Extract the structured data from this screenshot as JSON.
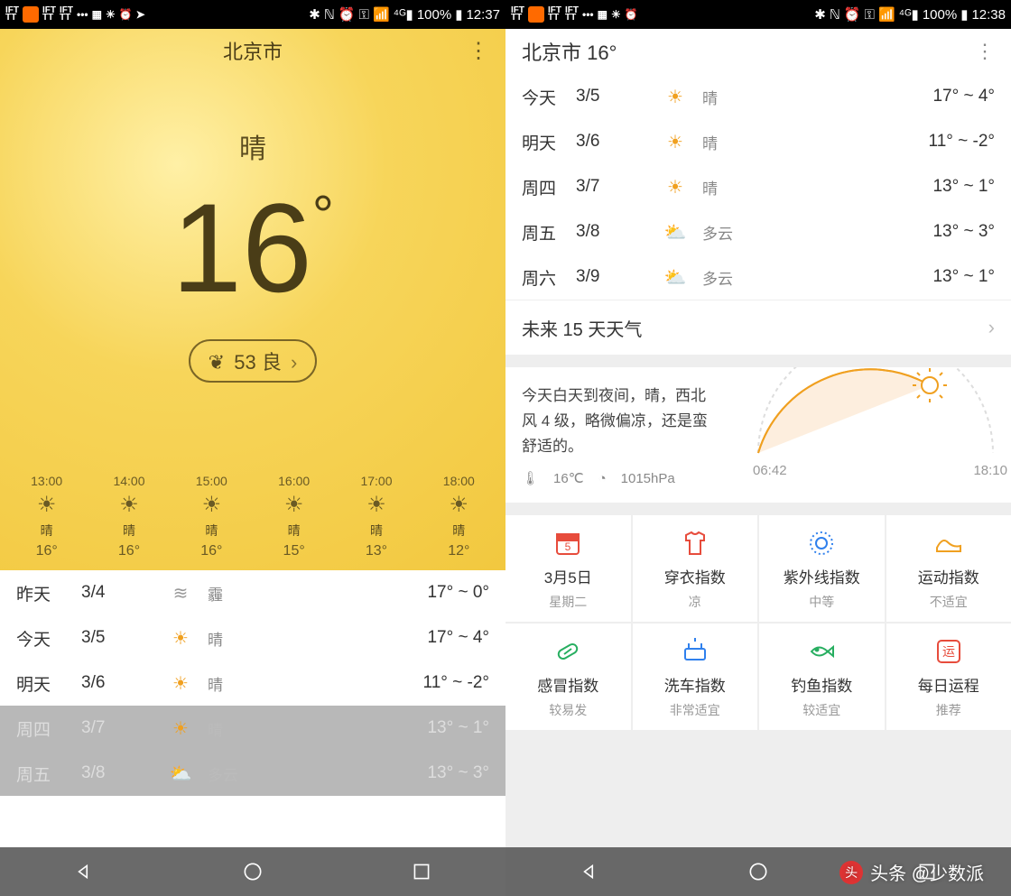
{
  "statusbar": {
    "left_items": [
      "IFT",
      "●",
      "IFT",
      "IFT",
      "•••"
    ],
    "battery": "100%",
    "time_left": "12:37",
    "time_right": "12:38"
  },
  "left": {
    "city": "北京市",
    "condition": "晴",
    "temp": "16",
    "aqi_value": "53",
    "aqi_label": "良",
    "hourly": [
      {
        "time": "13:00",
        "cond": "晴",
        "temp": "16°"
      },
      {
        "time": "14:00",
        "cond": "晴",
        "temp": "16°"
      },
      {
        "time": "15:00",
        "cond": "晴",
        "temp": "16°"
      },
      {
        "time": "16:00",
        "cond": "晴",
        "temp": "15°"
      },
      {
        "time": "17:00",
        "cond": "晴",
        "temp": "13°"
      },
      {
        "time": "18:00",
        "cond": "晴",
        "temp": "12°"
      }
    ],
    "daily": [
      {
        "day": "昨天",
        "date": "3/4",
        "icon": "haze",
        "cond": "霾",
        "range": "17° ~ 0°",
        "shade": false
      },
      {
        "day": "今天",
        "date": "3/5",
        "icon": "sun",
        "cond": "晴",
        "range": "17° ~ 4°",
        "shade": false
      },
      {
        "day": "明天",
        "date": "3/6",
        "icon": "sun",
        "cond": "晴",
        "range": "11° ~ -2°",
        "shade": false
      },
      {
        "day": "周四",
        "date": "3/7",
        "icon": "sun",
        "cond": "晴",
        "range": "13° ~ 1°",
        "shade": true
      },
      {
        "day": "周五",
        "date": "3/8",
        "icon": "cloud",
        "cond": "多云",
        "range": "13° ~ 3°",
        "shade": true
      }
    ]
  },
  "right": {
    "header": "北京市 16°",
    "daily": [
      {
        "day": "今天",
        "date": "3/5",
        "icon": "sun",
        "cond": "晴",
        "range": "17° ~ 4°"
      },
      {
        "day": "明天",
        "date": "3/6",
        "icon": "sun",
        "cond": "晴",
        "range": "11° ~ -2°"
      },
      {
        "day": "周四",
        "date": "3/7",
        "icon": "sun",
        "cond": "晴",
        "range": "13° ~ 1°"
      },
      {
        "day": "周五",
        "date": "3/8",
        "icon": "cloud",
        "cond": "多云",
        "range": "13° ~ 3°"
      },
      {
        "day": "周六",
        "date": "3/9",
        "icon": "cloud",
        "cond": "多云",
        "range": "13° ~ 1°"
      }
    ],
    "future_label": "未来 15 天天气",
    "summary_text": "今天白天到夜间，晴，西北风 4 级，略微偏凉，还是蛮舒适的。",
    "temp_now": "16℃",
    "pressure": "1015hPa",
    "sunrise": "06:42",
    "sunset": "18:10",
    "indices": [
      {
        "title": "3月5日",
        "sub": "星期二",
        "color": "#e74c3c",
        "glyph": "cal"
      },
      {
        "title": "穿衣指数",
        "sub": "凉",
        "color": "#e74c3c",
        "glyph": "shirt"
      },
      {
        "title": "紫外线指数",
        "sub": "中等",
        "color": "#2f80ed",
        "glyph": "uv"
      },
      {
        "title": "运动指数",
        "sub": "不适宜",
        "color": "#f0a020",
        "glyph": "shoe"
      },
      {
        "title": "感冒指数",
        "sub": "较易发",
        "color": "#27ae60",
        "glyph": "pill"
      },
      {
        "title": "洗车指数",
        "sub": "非常适宜",
        "color": "#2f80ed",
        "glyph": "car"
      },
      {
        "title": "钓鱼指数",
        "sub": "较适宜",
        "color": "#27ae60",
        "glyph": "fish"
      },
      {
        "title": "每日运程",
        "sub": "推荐",
        "color": "#e74c3c",
        "glyph": "luck"
      }
    ]
  },
  "watermark": "头条 @少数派"
}
